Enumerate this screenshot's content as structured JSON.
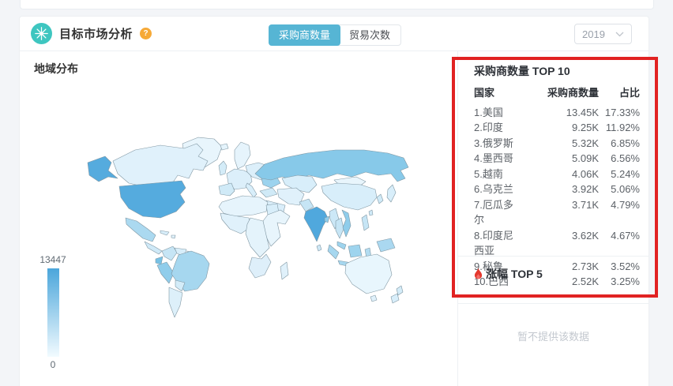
{
  "header": {
    "title": "目标市场分析",
    "tabs": [
      {
        "label": "采购商数量",
        "active": true
      },
      {
        "label": "贸易次数",
        "active": false
      }
    ],
    "year_select": {
      "value": "2019"
    }
  },
  "icons": {
    "help_glyph": "?"
  },
  "map_section": {
    "title": "地域分布",
    "legend": {
      "max": "13447",
      "min": "0"
    }
  },
  "top10": {
    "title": "采购商数量 TOP 10",
    "columns": {
      "country": "国家",
      "value": "采购商数量",
      "share": "占比"
    },
    "rows": [
      {
        "country": "1.美国",
        "value": "13.45K",
        "share": "17.33%"
      },
      {
        "country": "2.印度",
        "value": "9.25K",
        "share": "11.92%"
      },
      {
        "country": "3.俄罗斯",
        "value": "5.32K",
        "share": "6.85%"
      },
      {
        "country": "4.墨西哥",
        "value": "5.09K",
        "share": "6.56%"
      },
      {
        "country": "5.越南",
        "value": "4.06K",
        "share": "5.24%"
      },
      {
        "country": "6.乌克兰",
        "value": "3.92K",
        "share": "5.06%"
      },
      {
        "country": "7.厄瓜多尔",
        "value": "3.71K",
        "share": "4.79%"
      },
      {
        "country": "8.印度尼西亚",
        "value": "3.62K",
        "share": "4.67%"
      },
      {
        "country": "9.秘鲁",
        "value": "2.73K",
        "share": "3.52%"
      },
      {
        "country": "10.巴西",
        "value": "2.52K",
        "share": "3.25%"
      }
    ]
  },
  "gain": {
    "title": "涨幅 TOP 5",
    "empty_text": "暂不提供该数据"
  },
  "colors": {
    "accent_tab": "#56b5d4",
    "icon_teal": "#3ec6c0",
    "help_orange": "#f6a937",
    "annotation_red": "#e12222",
    "map_high": "#4ba6db",
    "flame_red": "#e4392f"
  },
  "map_regions": {
    "greenland": "#e8f5fc",
    "iceland": "#e4f3fb",
    "canada": "#e0f1fb",
    "alaska": "#55abde",
    "us": "#55abde",
    "mexico": "#abd9f0",
    "cuba": "#d8eefa",
    "hispaniola": "#e0f1fb",
    "central_america": "#cfe9f7",
    "colombia": "#c6e5f5",
    "venezuela": "#d8eefa",
    "guyana": "#e0f1fb",
    "ecuador": "#76c1e5",
    "peru": "#90cdeb",
    "brazil": "#a6d7ef",
    "bolivia": "#d4ecf8",
    "argentina": "#ddf0fa",
    "scandinavia": "#e6f4fc",
    "uk": "#d4ecf8",
    "west_europe": "#dceffa",
    "spain": "#d0eaf7",
    "italy": "#d8eefa",
    "east_europe": "#dceffa",
    "ukraine": "#9cd3ee",
    "russia": "#87c9e9",
    "kazakhstan": "#d8eefa",
    "turkey": "#d0eaf7",
    "middle_east": "#e0f1fb",
    "saudi": "#daeefa",
    "north_africa": "#e6f4fc",
    "egypt": "#d8eefa",
    "west_africa": "#e0f1fb",
    "east_africa": "#e8f5fc",
    "central_africa": "#e4f3fb",
    "south_africa": "#deeffa",
    "madagascar": "#e0f1fb",
    "pakistan": "#c6e5f5",
    "india": "#50a8dd",
    "bangladesh": "#8fcdeb",
    "sri_lanka": "#cfe9f7",
    "mongolia": "#e8f5fc",
    "china": "#d8eefa",
    "korea": "#d0eaf7",
    "japan": "#d8eefa",
    "taiwan": "#cfe9f7",
    "myanmar": "#cce8f7",
    "thailand": "#c6e5f5",
    "vietnam": "#8fcdeb",
    "malaysia": "#9ed4ee",
    "sumatra": "#a6d7ef",
    "borneo": "#9ed4ee",
    "java": "#a6d7ef",
    "sulawesi": "#b2dcf1",
    "philippines": "#c6e5f5",
    "new_guinea": "#aad8f0",
    "australia": "#e8f6fd",
    "tasmania": "#e0f1fb",
    "nz_north": "#d4ecf8",
    "nz_south": "#d8eefa"
  },
  "chart_data": {
    "type": "choropleth_map",
    "title": "地域分布",
    "metric": "采购商数量",
    "year": "2019",
    "colorbar": {
      "min": 0,
      "max": 13447
    },
    "series": [
      {
        "name": "美国",
        "value": 13450,
        "value_display": "13.45K",
        "share_pct": 17.33
      },
      {
        "name": "印度",
        "value": 9250,
        "value_display": "9.25K",
        "share_pct": 11.92
      },
      {
        "name": "俄罗斯",
        "value": 5320,
        "value_display": "5.32K",
        "share_pct": 6.85
      },
      {
        "name": "墨西哥",
        "value": 5090,
        "value_display": "5.09K",
        "share_pct": 6.56
      },
      {
        "name": "越南",
        "value": 4060,
        "value_display": "4.06K",
        "share_pct": 5.24
      },
      {
        "name": "乌克兰",
        "value": 3920,
        "value_display": "3.92K",
        "share_pct": 5.06
      },
      {
        "name": "厄瓜多尔",
        "value": 3710,
        "value_display": "3.71K",
        "share_pct": 4.79
      },
      {
        "name": "印度尼西亚",
        "value": 3620,
        "value_display": "3.62K",
        "share_pct": 4.67
      },
      {
        "name": "秘鲁",
        "value": 2730,
        "value_display": "2.73K",
        "share_pct": 3.52
      },
      {
        "name": "巴西",
        "value": 2520,
        "value_display": "2.52K",
        "share_pct": 3.25
      }
    ]
  }
}
